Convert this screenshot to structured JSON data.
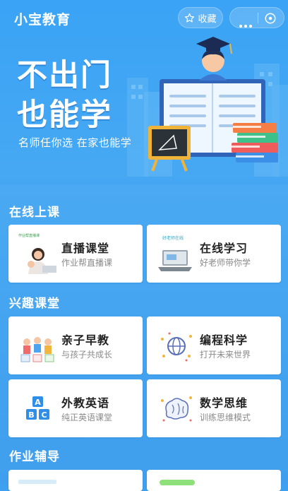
{
  "header": {
    "title": "小宝教育",
    "favorite_label": "收藏",
    "favorite_icon": "star-outline-icon",
    "more_icon": "more-dots-icon",
    "close_icon": "close-circle-icon"
  },
  "banner": {
    "headline_line1": "不出门",
    "headline_line2": "也能学",
    "subtitle": "名师任你选 在家也能学"
  },
  "sections": [
    {
      "title": "在线上课",
      "cards": [
        {
          "title": "直播课堂",
          "subtitle": "作业帮直播课",
          "thumb_caption": "作业帮直播课"
        },
        {
          "title": "在线学习",
          "subtitle": "好老师带你学",
          "thumb_caption": "好老师在线"
        }
      ]
    },
    {
      "title": "兴趣课堂",
      "cards": [
        {
          "title": "亲子早教",
          "subtitle": "与孩子共成长"
        },
        {
          "title": "编程科学",
          "subtitle": "打开未来世界"
        },
        {
          "title": "外教英语",
          "subtitle": "纯正英语课堂"
        },
        {
          "title": "数学思维",
          "subtitle": "训练思维模式"
        }
      ]
    },
    {
      "title": "作业辅导",
      "cards": [
        {
          "title": ""
        },
        {
          "title": ""
        }
      ]
    }
  ],
  "colors": {
    "background_blue": "#3ea0f0",
    "card_white": "#ffffff",
    "title_dark": "#222222",
    "subtitle_gray": "#8a8a8a"
  }
}
